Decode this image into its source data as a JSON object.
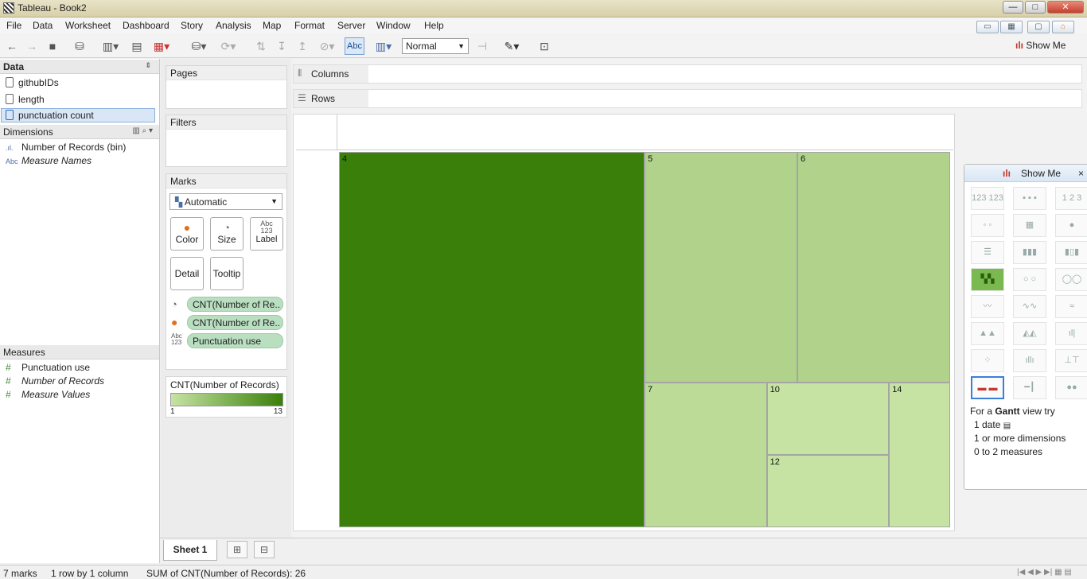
{
  "window": {
    "title": "Tableau - Book2",
    "min": "—",
    "max": "□",
    "close": "✕"
  },
  "menu": [
    "File",
    "Data",
    "Worksheet",
    "Dashboard",
    "Story",
    "Analysis",
    "Map",
    "Format",
    "Server",
    "Window",
    "Help"
  ],
  "toolbar": {
    "abc": "Abc",
    "fit": "Normal",
    "show_me": "Show Me"
  },
  "data_pane": {
    "title": "Data",
    "sources": [
      "githubIDs",
      "length",
      "punctuation count"
    ],
    "dimensions_title": "Dimensions",
    "dimensions": [
      {
        "icon": ".ıl.",
        "label": "Number of Records (bin)"
      },
      {
        "icon": "Abc",
        "label": "Measure Names"
      }
    ],
    "measures_title": "Measures",
    "measures": [
      {
        "icon": "#",
        "label": "Punctuation use"
      },
      {
        "icon": "#",
        "label": "Number of Records"
      },
      {
        "icon": "#",
        "label": "Measure Values"
      }
    ]
  },
  "cards": {
    "pages": "Pages",
    "filters": "Filters",
    "marks": "Marks",
    "mark_type": "Automatic",
    "buttons": {
      "color": "Color",
      "size": "Size",
      "label": "Label",
      "label_icon": "Abc\n123",
      "detail": "Detail",
      "tooltip": "Tooltip"
    },
    "pills": [
      {
        "icon": "◔",
        "label": "CNT(Number of Re.."
      },
      {
        "icon": "●",
        "label": "CNT(Number of Re.."
      },
      {
        "icon": "Abc\n123",
        "label": "Punctuation use"
      }
    ],
    "legend_title": "CNT(Number of Records)",
    "legend_min": "1",
    "legend_max": "13",
    "colors": {
      "low": "#c7e3a3",
      "high": "#3a7f0a"
    }
  },
  "shelves": {
    "columns": "Columns",
    "rows": "Rows"
  },
  "chart_data": {
    "type": "treemap",
    "labels": [
      "4",
      "5",
      "6",
      "7",
      "10",
      "12",
      "14"
    ],
    "values": [
      13,
      3,
      3,
      2,
      1,
      1,
      1
    ],
    "color_scale": [
      1,
      13
    ]
  },
  "show_me": {
    "title": "Show Me",
    "hint": {
      "prefix": "For a ",
      "type": "Gantt",
      "suffix": " view try",
      "lines": [
        "1 date",
        "1 or more dimensions",
        "0 to 2 measures"
      ]
    }
  },
  "tabs": {
    "sheet": "Sheet 1"
  },
  "status": {
    "marks": "7 marks",
    "grid": "1 row by 1 column",
    "sum": "SUM of CNT(Number of Records): 26"
  }
}
